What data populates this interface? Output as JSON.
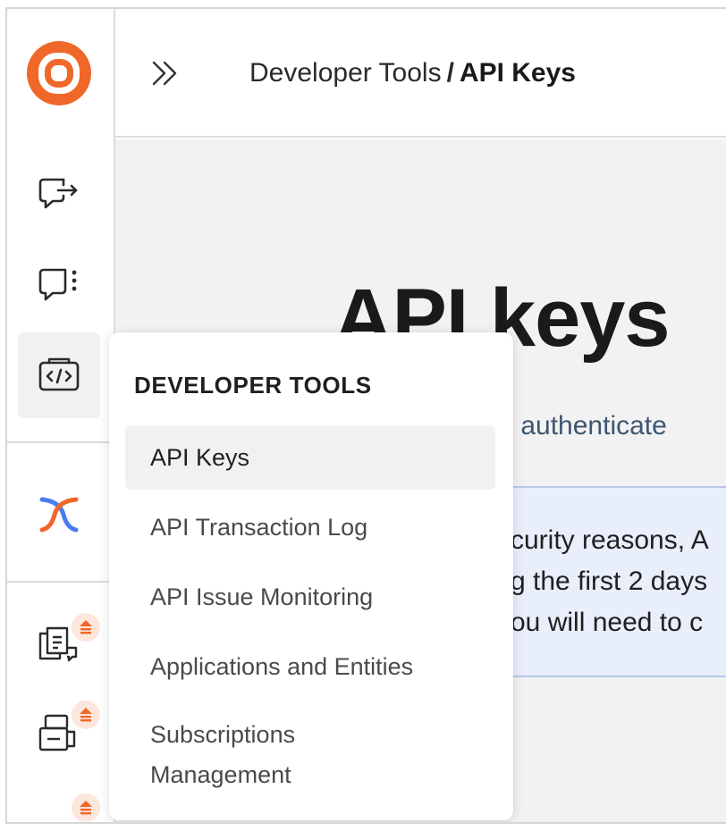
{
  "breadcrumb": {
    "parent": "Developer Tools",
    "separator": "/",
    "current": "API Keys"
  },
  "main": {
    "title": "API keys",
    "subtitle_fragment": "to authenticate",
    "notice_lines": [
      "curity reasons, A",
      "g the first 2 days",
      "ou will need to c"
    ]
  },
  "menu": {
    "heading": "DEVELOPER TOOLS",
    "items": [
      {
        "label": "API Keys",
        "selected": true
      },
      {
        "label": "API Transaction Log",
        "selected": false
      },
      {
        "label": "API Issue Monitoring",
        "selected": false
      },
      {
        "label": "Applications and Entities",
        "selected": false
      },
      {
        "label": "Subscriptions Management",
        "selected": false
      }
    ]
  },
  "colors": {
    "brand": "#f0672a",
    "accent_blue": "#4a7cf0",
    "notice_bg": "#e9eefb",
    "badge_bg": "#fde6dc"
  },
  "icons": {
    "logo": "concentric-logo-icon",
    "sidebar": [
      "export-chat-icon",
      "chat-menu-icon",
      "developer-code-icon",
      "integration-x-icon",
      "documents-chat-icon",
      "stacked-forms-icon",
      "more-icon"
    ],
    "expand": "double-chevron-right-icon"
  }
}
